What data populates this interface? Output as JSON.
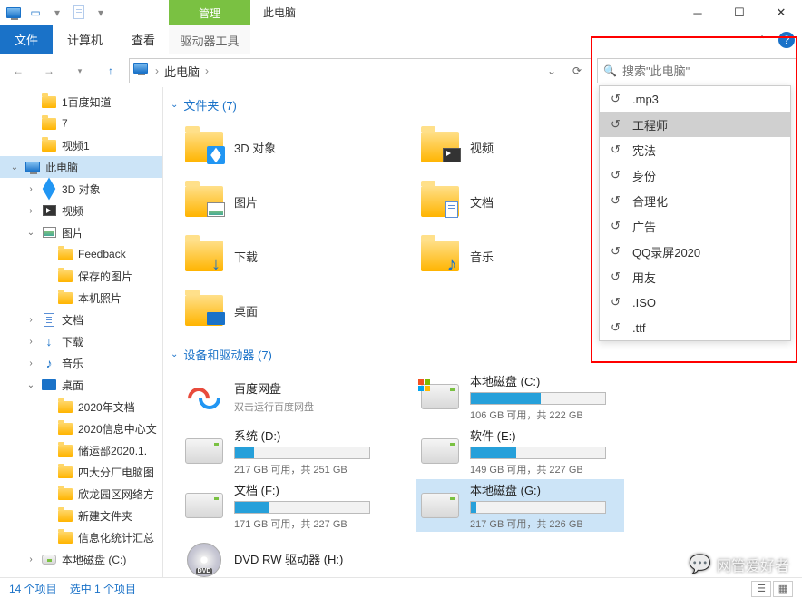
{
  "title": "此电脑",
  "context_tab": {
    "group": "管理",
    "label": "驱动器工具"
  },
  "ribbon_tabs": {
    "file": "文件",
    "computer": "计算机",
    "view": "查看"
  },
  "address": {
    "crumb": "此电脑",
    "sep": "›"
  },
  "search": {
    "placeholder": "搜索\"此电脑\""
  },
  "sidebar": {
    "top": [
      {
        "label": "1百度知道",
        "type": "folder"
      },
      {
        "label": "7",
        "type": "folder"
      },
      {
        "label": "视频1",
        "type": "folder"
      }
    ],
    "pc_label": "此电脑",
    "pc_children": [
      {
        "label": "3D 对象",
        "icon": "3d"
      },
      {
        "label": "视频",
        "icon": "vid"
      },
      {
        "label": "图片",
        "icon": "pic",
        "expanded": true,
        "children": [
          {
            "label": "Feedback"
          },
          {
            "label": "保存的图片"
          },
          {
            "label": "本机照片"
          }
        ]
      },
      {
        "label": "文档",
        "icon": "doc"
      },
      {
        "label": "下载",
        "icon": "dl"
      },
      {
        "label": "音乐",
        "icon": "music"
      },
      {
        "label": "桌面",
        "icon": "desktop",
        "expanded": true,
        "children": [
          {
            "label": "2020年文档"
          },
          {
            "label": "2020信息中心文"
          },
          {
            "label": "储运部2020.1."
          },
          {
            "label": "四大分厂电脑图"
          },
          {
            "label": "欣龙园区网络方"
          },
          {
            "label": "新建文件夹"
          },
          {
            "label": "信息化统计汇总"
          }
        ]
      },
      {
        "label": "本地磁盘 (C:)",
        "icon": "drive"
      }
    ]
  },
  "groups": {
    "folders": {
      "header": "文件夹 (7)",
      "items": [
        {
          "label": "3D 对象",
          "icon": "3d"
        },
        {
          "label": "视频",
          "icon": "vid"
        },
        {
          "label": "图片",
          "icon": "pic"
        },
        {
          "label": "文档",
          "icon": "doc"
        },
        {
          "label": "下载",
          "icon": "dl"
        },
        {
          "label": "音乐",
          "icon": "music"
        },
        {
          "label": "桌面",
          "icon": "desktop"
        }
      ]
    },
    "drives": {
      "header": "设备和驱动器 (7)",
      "items": [
        {
          "label": "百度网盘",
          "sub": "双击运行百度网盘",
          "kind": "baidu"
        },
        {
          "label": "本地磁盘 (C:)",
          "free": "106 GB 可用，共 222 GB",
          "pct": 52,
          "winov": true
        },
        {
          "label": "系统 (D:)",
          "free": "217 GB 可用，共 251 GB",
          "pct": 14
        },
        {
          "label": "软件 (E:)",
          "free": "149 GB 可用，共 227 GB",
          "pct": 34
        },
        {
          "label": "文档 (F:)",
          "free": "171 GB 可用，共 227 GB",
          "pct": 25
        },
        {
          "label": "本地磁盘 (G:)",
          "free": "217 GB 可用，共 226 GB",
          "pct": 4,
          "selected": true
        },
        {
          "label": "DVD RW 驱动器 (H:)",
          "kind": "dvd"
        }
      ]
    }
  },
  "history": {
    "items": [
      ".mp3",
      "工程师",
      "宪法",
      "身份",
      "合理化",
      "广告",
      "QQ录屏2020",
      "用友",
      ".ISO",
      ".ttf"
    ],
    "selected_index": 1
  },
  "status": {
    "count": "14 个项目",
    "selected": "选中 1 个项目"
  },
  "watermark": "网管爱好者"
}
